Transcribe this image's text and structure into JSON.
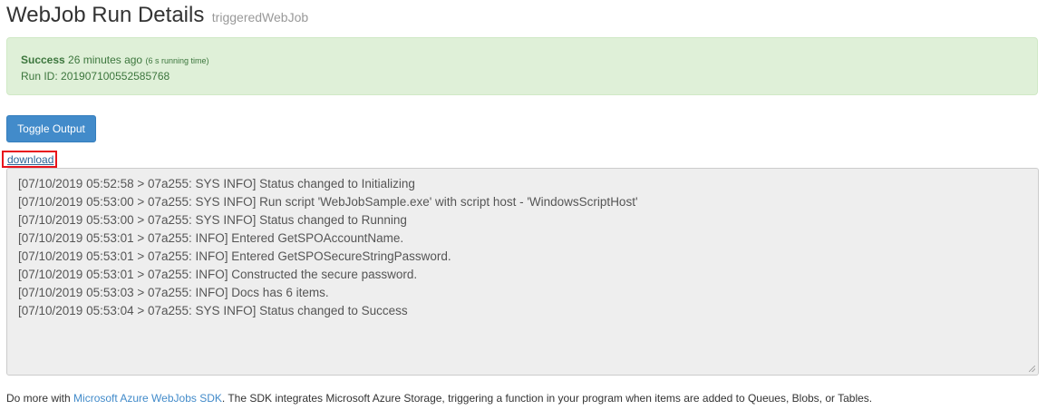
{
  "header": {
    "title": "WebJob Run Details",
    "subtitle": "triggeredWebJob"
  },
  "status": {
    "state": "Success",
    "ago": "26 minutes ago",
    "running_time": "(6 s running time)",
    "run_id_label": "Run ID:",
    "run_id": "201907100552585768"
  },
  "actions": {
    "toggle_label": "Toggle Output",
    "download_label": "download"
  },
  "log": {
    "lines": [
      "[07/10/2019 05:52:58 > 07a255: SYS INFO] Status changed to Initializing",
      "[07/10/2019 05:53:00 > 07a255: SYS INFO] Run script 'WebJobSample.exe' with script host - 'WindowsScriptHost'",
      "[07/10/2019 05:53:00 > 07a255: SYS INFO] Status changed to Running",
      "[07/10/2019 05:53:01 > 07a255: INFO] Entered GetSPOAccountName.",
      "[07/10/2019 05:53:01 > 07a255: INFO] Entered GetSPOSecureStringPassword.",
      "[07/10/2019 05:53:01 > 07a255: INFO] Constructed the secure password.",
      "[07/10/2019 05:53:03 > 07a255: INFO] Docs has 6 items.",
      "[07/10/2019 05:53:04 > 07a255: SYS INFO] Status changed to Success"
    ]
  },
  "footer": {
    "prefix": "Do more with ",
    "link_text": "Microsoft Azure WebJobs SDK",
    "suffix": ". The SDK integrates Microsoft Azure Storage, triggering a function in your program when items are added to Queues, Blobs, or Tables."
  },
  "colors": {
    "success_bg": "#dff0d8",
    "success_text": "#3c763d",
    "button_bg": "#428bca",
    "link": "#428bca",
    "highlight_border": "#e8141c",
    "log_bg": "#eeeeee"
  }
}
